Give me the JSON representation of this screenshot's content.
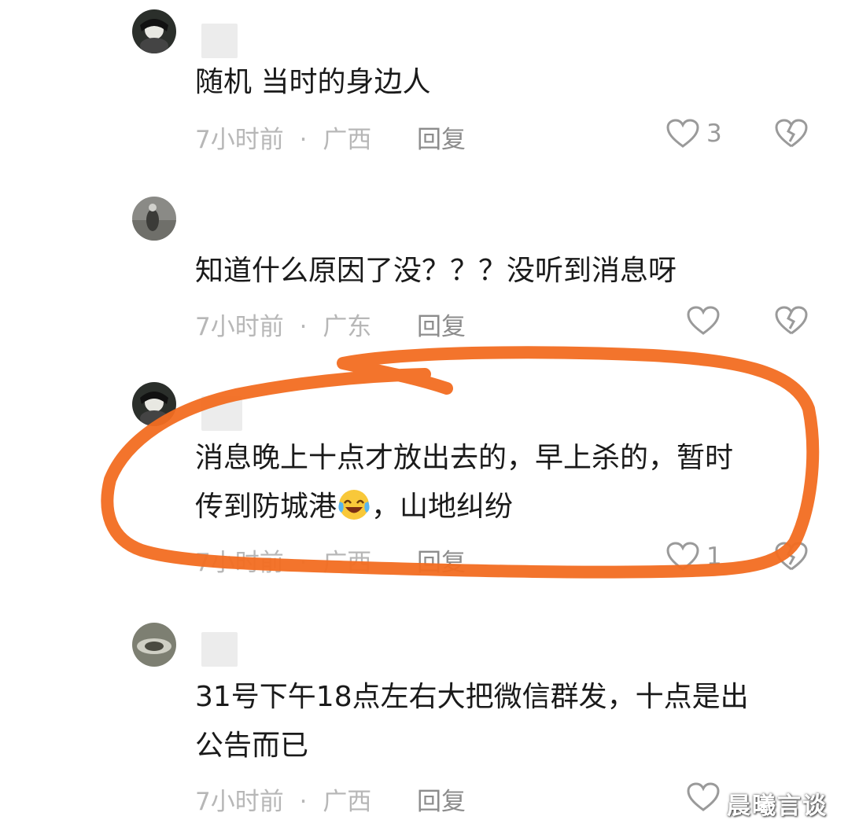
{
  "comments": [
    {
      "text": "随机 当时的身边人",
      "time": "7小时前",
      "location": "广西",
      "reply": "回复",
      "likes": "3"
    },
    {
      "text": "知道什么原因了没？？？没听到消息呀",
      "time": "7小时前",
      "location": "广东",
      "reply": "回复",
      "likes": ""
    },
    {
      "text_line1": "消息晚上十点才放出去的，早上杀的，暂时",
      "text_line2a": "传到防城港",
      "text_line2b": "，山地纠纷",
      "time": "7小时前",
      "location": "广西",
      "reply": "回复",
      "likes": "1"
    },
    {
      "text_line1": "31号下午18点左右大把微信群发，十点是出",
      "text_line2": "公告而已",
      "time": "7小时前",
      "location": "广西",
      "reply": "回复",
      "likes": ""
    }
  ],
  "separator": "·",
  "watermark": "晨曦言谈",
  "colors": {
    "annotation": "#f26d21",
    "text": "#1a1a1a",
    "meta": "#b7b7b7",
    "icon": "#9a9a9a"
  },
  "icons": [
    "like-heart-icon",
    "dislike-broken-heart-icon",
    "laughing-crying-emoji"
  ]
}
